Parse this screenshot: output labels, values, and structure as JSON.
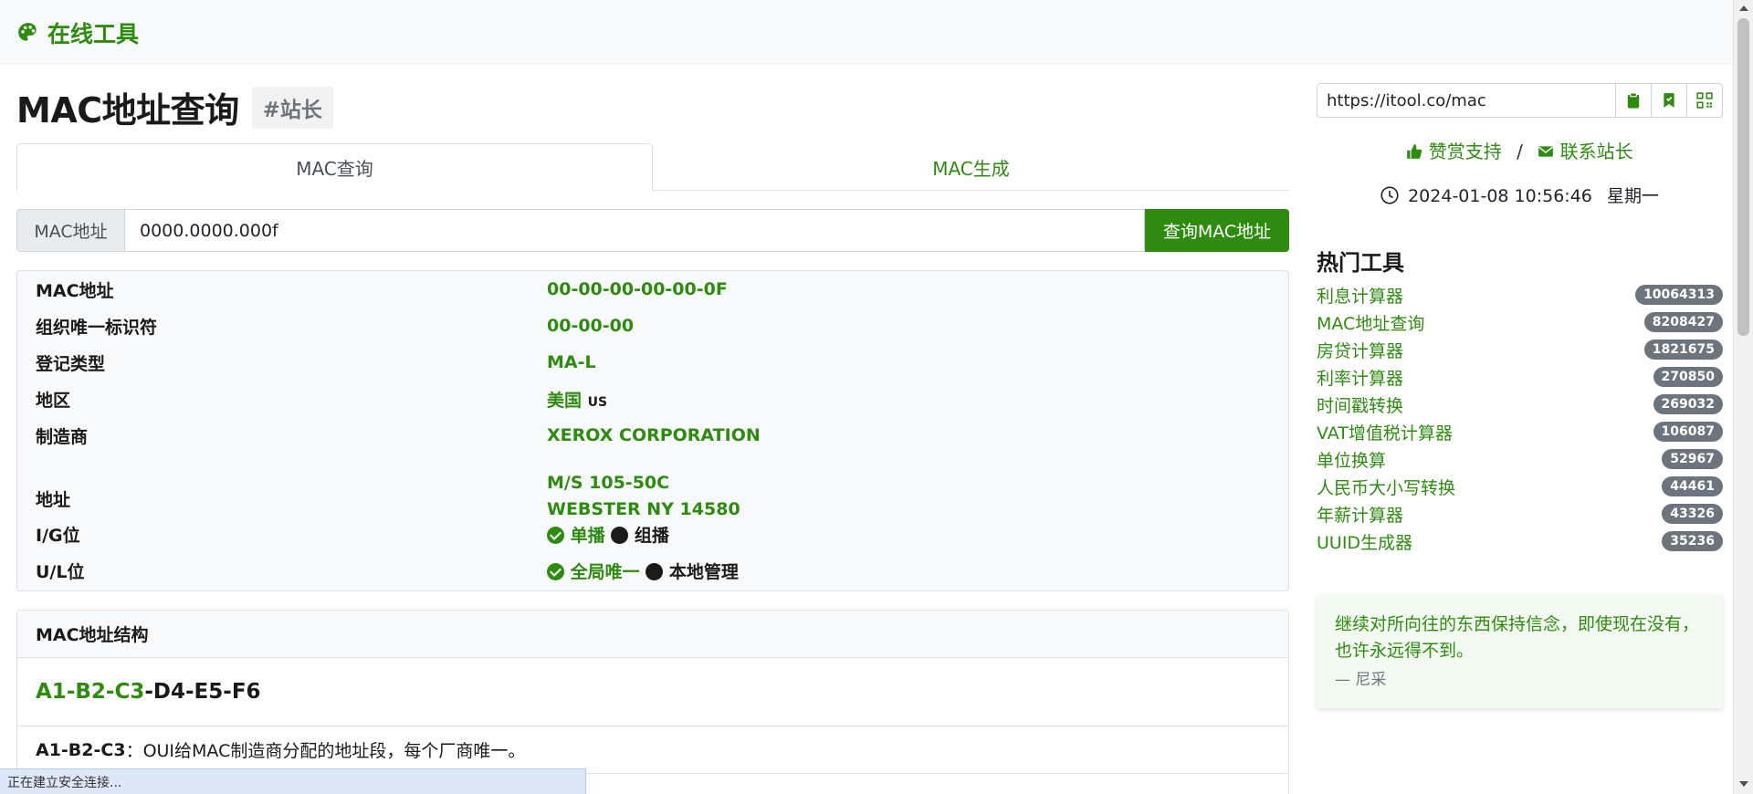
{
  "brand": {
    "name": "在线工具",
    "icon": "palette-icon"
  },
  "page": {
    "title": "MAC地址查询",
    "tag": "#站长"
  },
  "tabs": [
    {
      "label": "MAC查询",
      "active": true
    },
    {
      "label": "MAC生成",
      "active": false
    }
  ],
  "query": {
    "label": "MAC地址",
    "value": "0000.0000.000f",
    "button": "查询MAC地址"
  },
  "result": {
    "mac": {
      "key": "MAC地址",
      "value": "00-00-00-00-00-0F"
    },
    "oui": {
      "key": "组织唯一标识符",
      "value": "00-00-00"
    },
    "reg_type": {
      "key": "登记类型",
      "value": "MA-L"
    },
    "region": {
      "key": "地区",
      "value": "美国",
      "code": "US"
    },
    "vendor": {
      "key": "制造商",
      "value": "XEROX CORPORATION"
    },
    "address": {
      "key": "地址",
      "line1": "M/S 105-50C",
      "line2": "WEBSTER NY 14580"
    },
    "ig": {
      "key": "I/G位",
      "selected": "单播",
      "other": "组播"
    },
    "ul": {
      "key": "U/L位",
      "selected": "全局唯一",
      "other": "本地管理"
    }
  },
  "structure": {
    "title": "MAC地址结构",
    "example_parts": [
      "A1",
      "B2",
      "C3",
      "D4",
      "E5",
      "F6"
    ],
    "desc_key": "A1-B2-C3",
    "desc_text": "：OUI给MAC制造商分配的地址段，每个厂商唯一。"
  },
  "status_text": "正在建立安全连接...",
  "sidebar": {
    "url": "https://itool.co/mac",
    "support": "赞赏支持",
    "separator": "/",
    "contact": "联系站长",
    "datetime": "2024-01-08 10:56:46",
    "weekday": "星期一",
    "hot_title": "热门工具",
    "hot_tools": [
      {
        "name": "利息计算器",
        "count": "10064313"
      },
      {
        "name": "MAC地址查询",
        "count": "8208427"
      },
      {
        "name": "房贷计算器",
        "count": "1821675"
      },
      {
        "name": "利率计算器",
        "count": "270850"
      },
      {
        "name": "时间戳转换",
        "count": "269032"
      },
      {
        "name": "VAT增值税计算器",
        "count": "106087"
      },
      {
        "name": "单位换算",
        "count": "52967"
      },
      {
        "name": "人民币大小写转换",
        "count": "44461"
      },
      {
        "name": "年薪计算器",
        "count": "43326"
      },
      {
        "name": "UUID生成器",
        "count": "35236"
      }
    ],
    "quote": {
      "text": "继续对所向往的东西保持信念，即使现在没有，也许永远得不到。",
      "author": "—   尼采"
    }
  },
  "colors": {
    "accent": "#2e8b10",
    "badge": "#6c757d"
  }
}
